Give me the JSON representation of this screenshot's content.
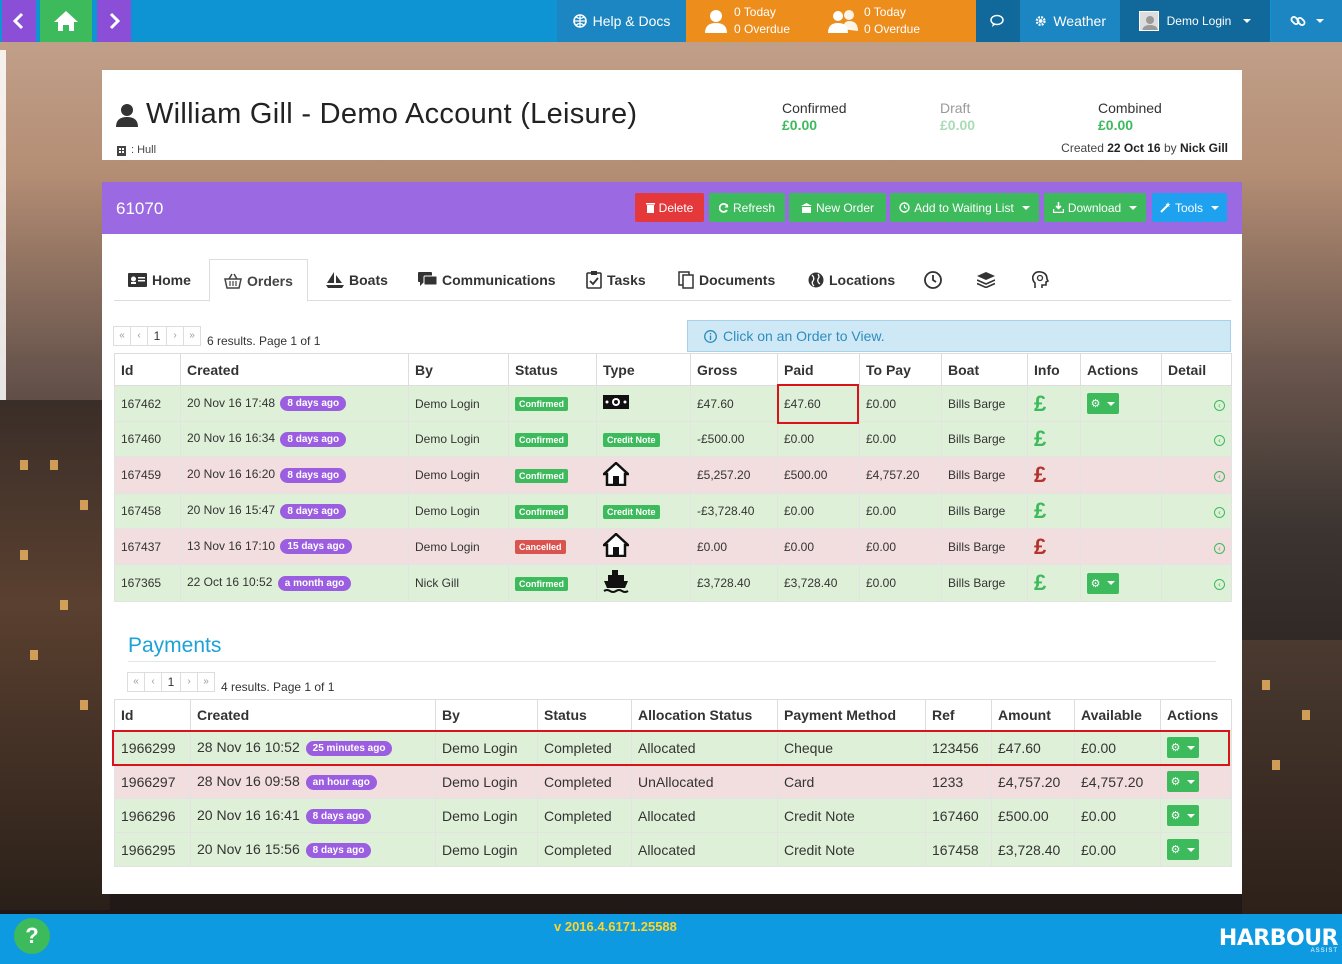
{
  "topbar": {
    "help_label": "Help & Docs",
    "alert1_today": "0 Today",
    "alert1_overdue": "0 Overdue",
    "alert2_today": "0 Today",
    "alert2_overdue": "0 Overdue",
    "weather_label": "Weather",
    "user_label": "Demo Login"
  },
  "account": {
    "title": "William Gill - Demo Account (Leisure)",
    "location": ": Hull",
    "confirmed_label": "Confirmed",
    "confirmed_value": "£0.00",
    "draft_label": "Draft",
    "draft_value": "£0.00",
    "combined_label": "Combined",
    "combined_value": "£0.00",
    "created_prefix": "Created",
    "created_date": "22 Oct 16",
    "created_by_word": "by",
    "created_by": "Nick Gill"
  },
  "panel": {
    "account_number": "61070",
    "buttons": {
      "delete": "Delete",
      "refresh": "Refresh",
      "new_order": "New Order",
      "waiting_list": "Add to Waiting List",
      "download": "Download",
      "tools": "Tools"
    }
  },
  "tabs": {
    "home": "Home",
    "orders": "Orders",
    "boats": "Boats",
    "communications": "Communications",
    "tasks": "Tasks",
    "documents": "Documents",
    "locations": "Locations"
  },
  "orders": {
    "pager_page": "1",
    "results_info": "6 results. Page 1 of 1",
    "hint": "Click on an Order to View.",
    "columns": [
      "Id",
      "Created",
      "By",
      "Status",
      "Type",
      "Gross",
      "Paid",
      "To Pay",
      "Boat",
      "Info",
      "Actions",
      "Detail"
    ],
    "rows": [
      {
        "id": "167462",
        "created": "20 Nov 16 17:48",
        "ago": "8 days ago",
        "by": "Demo Login",
        "status": "Confirmed",
        "type": "money",
        "gross": "£47.60",
        "paid": "£47.60",
        "topay": "£0.00",
        "boat": "Bills Barge"
      },
      {
        "id": "167460",
        "created": "20 Nov 16 16:34",
        "ago": "8 days ago",
        "by": "Demo Login",
        "status": "Confirmed",
        "type": "Credit Note",
        "gross": "-£500.00",
        "paid": "£0.00",
        "topay": "£0.00",
        "boat": "Bills Barge"
      },
      {
        "id": "167459",
        "created": "20 Nov 16 16:20",
        "ago": "8 days ago",
        "by": "Demo Login",
        "status": "Confirmed",
        "type": "home",
        "gross": "£5,257.20",
        "paid": "£500.00",
        "topay": "£4,757.20",
        "boat": "Bills Barge"
      },
      {
        "id": "167458",
        "created": "20 Nov 16 15:47",
        "ago": "8 days ago",
        "by": "Demo Login",
        "status": "Confirmed",
        "type": "Credit Note",
        "gross": "-£3,728.40",
        "paid": "£0.00",
        "topay": "£0.00",
        "boat": "Bills Barge"
      },
      {
        "id": "167437",
        "created": "13 Nov 16 17:10",
        "ago": "15 days ago",
        "by": "Demo Login",
        "status": "Cancelled",
        "type": "home",
        "gross": "£0.00",
        "paid": "£0.00",
        "topay": "£0.00",
        "boat": "Bills Barge"
      },
      {
        "id": "167365",
        "created": "22 Oct 16 10:52",
        "ago": "a month ago",
        "by": "Nick Gill",
        "status": "Confirmed",
        "type": "boat",
        "gross": "£3,728.40",
        "paid": "£3,728.40",
        "topay": "£0.00",
        "boat": "Bills Barge"
      }
    ],
    "pound": "£"
  },
  "payments": {
    "title": "Payments",
    "pager_page": "1",
    "results_info": "4 results. Page 1 of 1",
    "columns": [
      "Id",
      "Created",
      "By",
      "Status",
      "Allocation Status",
      "Payment Method",
      "Ref",
      "Amount",
      "Available",
      "Actions"
    ],
    "rows": [
      {
        "id": "1966299",
        "created": "28 Nov 16 10:52",
        "ago": "25 minutes ago",
        "by": "Demo Login",
        "status": "Completed",
        "alloc": "Allocated",
        "method": "Cheque",
        "ref": "123456",
        "amount": "£47.60",
        "available": "£0.00"
      },
      {
        "id": "1966297",
        "created": "28 Nov 16 09:58",
        "ago": "an hour ago",
        "by": "Demo Login",
        "status": "Completed",
        "alloc": "UnAllocated",
        "method": "Card",
        "ref": "1233",
        "amount": "£4,757.20",
        "available": "£4,757.20"
      },
      {
        "id": "1966296",
        "created": "20 Nov 16 16:41",
        "ago": "8 days ago",
        "by": "Demo Login",
        "status": "Completed",
        "alloc": "Allocated",
        "method": "Credit Note",
        "ref": "167460",
        "amount": "£500.00",
        "available": "£0.00"
      },
      {
        "id": "1966295",
        "created": "20 Nov 16 15:56",
        "ago": "8 days ago",
        "by": "Demo Login",
        "status": "Completed",
        "alloc": "Allocated",
        "method": "Credit Note",
        "ref": "167458",
        "amount": "£3,728.40",
        "available": "£0.00"
      }
    ]
  },
  "footer": {
    "version": "v 2016.4.6171.25588",
    "help": "?",
    "brand": "HARBOUR",
    "brand_sub": "ASSIST"
  },
  "colors": {
    "purple": "#9b6ae3",
    "green": "#3dba5c",
    "red": "#e5383b",
    "blue": "#0e93d3",
    "orange": "#ec8d1c"
  }
}
